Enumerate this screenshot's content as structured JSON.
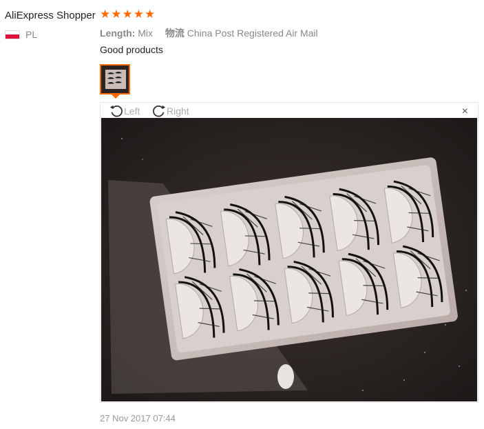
{
  "reviewer": {
    "name": "AliExpress Shopper",
    "country": "PL"
  },
  "rating": {
    "value": 5,
    "max": 5,
    "color": "#ff6a00"
  },
  "attributes": {
    "length_label": "Length:",
    "length_value": "Mix",
    "logistics_label": "物流",
    "logistics_value": "China Post Registered Air Mail"
  },
  "review": {
    "text": "Good products",
    "date": "27 Nov 2017 07:44"
  },
  "viewer": {
    "rotate_left_label": "Left",
    "rotate_right_label": "Right",
    "close_label": "×"
  },
  "icons": {
    "rotate_left": "rotate-left-icon",
    "rotate_right": "rotate-right-icon",
    "close": "close-icon",
    "flag": "poland-flag-icon",
    "star": "star-icon"
  },
  "colors": {
    "accent": "#ff6a00",
    "flag_red": "#dc143c"
  }
}
